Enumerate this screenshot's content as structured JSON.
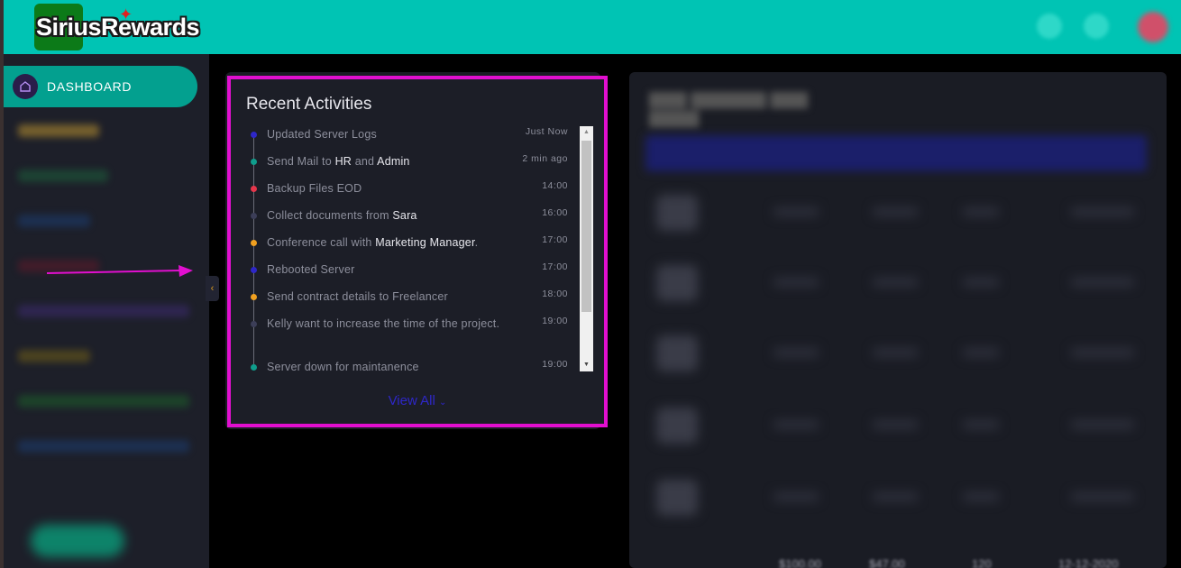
{
  "header": {
    "logo_text": "SiriusRewards",
    "colors": {
      "bar": "#00c4b4",
      "logo_box": "#0c7a18"
    }
  },
  "sidebar": {
    "active_item": {
      "label": "DASHBOARD",
      "icon": "home-icon"
    },
    "collapse_icon": "chevron-left-icon"
  },
  "recent_activities": {
    "title": "Recent Activities",
    "items": [
      {
        "text": "Updated Server Logs",
        "highlights": [],
        "time": "Just Now",
        "dot_color": "#2e27c8"
      },
      {
        "text": "Send Mail to HR and Admin",
        "highlights": [
          "HR",
          "Admin"
        ],
        "time": "2 min ago",
        "dot_color": "#0f9d8c"
      },
      {
        "text": "Backup Files EOD",
        "highlights": [],
        "time": "14:00",
        "dot_color": "#e5364b"
      },
      {
        "text": "Collect documents from Sara",
        "highlights": [
          "Sara"
        ],
        "time": "16:00",
        "dot_color": "#3c3e58"
      },
      {
        "text": "Conference call with Marketing Manager.",
        "highlights": [
          "Marketing Manager"
        ],
        "time": "17:00",
        "dot_color": "#f0a020"
      },
      {
        "text": "Rebooted Server",
        "highlights": [],
        "time": "17:00",
        "dot_color": "#2e27c8"
      },
      {
        "text": "Send contract details to Freelancer",
        "highlights": [],
        "time": "18:00",
        "dot_color": "#f0a020"
      },
      {
        "text": "Kelly want to increase the time of the project.",
        "highlights": [],
        "time": "19:00",
        "dot_color": "#3c3e58"
      },
      {
        "text": "Server down for maintanence",
        "highlights": [],
        "time": "19:00",
        "dot_color": "#0f9d8c"
      }
    ],
    "view_all_label": "View All",
    "view_all_icon": "chevron-down-icon"
  },
  "right_panel": {
    "bottom_row_values": [
      "$100.00",
      "$47.00",
      "120",
      "12-12-2020"
    ]
  },
  "annotation": {
    "highlight_color": "#e10fcf"
  }
}
